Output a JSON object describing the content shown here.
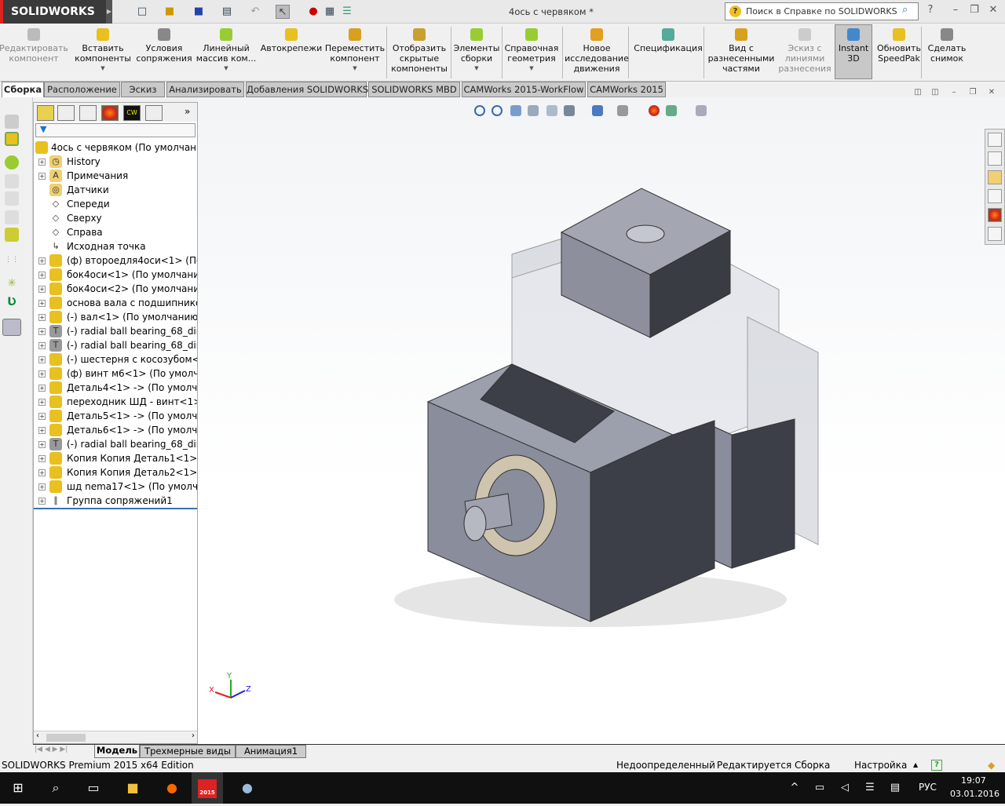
{
  "app": {
    "brand": "SOLIDWORKS",
    "document_title": "4ось с червяком *",
    "help_search_placeholder": "Поиск в Справке по SOLIDWORKS",
    "help_icon": "?"
  },
  "ribbon": {
    "buttons": [
      {
        "label": "Редактировать\nкомпонент",
        "disabled": true,
        "icon": "edit-component-icon"
      },
      {
        "label": "Вставить\nкомпоненты",
        "icon": "insert-components-icon",
        "dropdown": true
      },
      {
        "label": "Условия\nсопряжения",
        "icon": "mate-icon"
      },
      {
        "label": "Линейный\nмассив ком...",
        "icon": "linear-pattern-icon",
        "dropdown": true
      },
      {
        "label": "Автокрепежи",
        "icon": "smart-fasteners-icon"
      },
      {
        "label": "Переместить\nкомпонент",
        "icon": "move-component-icon",
        "dropdown": true
      },
      {
        "label": "Отобразить\nскрытые\nкомпоненты",
        "icon": "show-hidden-icon"
      },
      {
        "label": "Элементы\nсборки",
        "icon": "assembly-features-icon",
        "dropdown": true
      },
      {
        "label": "Справочная\nгеометрия",
        "icon": "reference-geometry-icon",
        "dropdown": true
      },
      {
        "label": "Новое\nисследование\nдвижения",
        "icon": "motion-study-icon"
      },
      {
        "label": "Спецификация",
        "icon": "bom-icon"
      },
      {
        "label": "Вид с\nразнесенными\nчастями",
        "icon": "exploded-view-icon"
      },
      {
        "label": "Эскиз с\nлиниями\nразнесения",
        "disabled": true,
        "icon": "explode-line-sketch-icon"
      },
      {
        "label": "Instant\n3D",
        "active": true,
        "icon": "instant3d-icon"
      },
      {
        "label": "Обновить\nSpeedPak",
        "icon": "speedpak-icon"
      },
      {
        "label": "Сделать\nснимок",
        "icon": "snapshot-icon"
      }
    ]
  },
  "tabs": [
    "Сборка",
    "Расположение",
    "Эскиз",
    "Анализировать",
    "Добавления SOLIDWORKS",
    "SOLIDWORKS MBD",
    "CAMWorks 2015-WorkFlow",
    "CAMWorks 2015"
  ],
  "tree": {
    "root": "4ось с червяком  (По умолчанию",
    "items": [
      {
        "label": "History",
        "icon": "history-icon",
        "expand": true
      },
      {
        "label": "Примечания",
        "icon": "annotations-icon",
        "expand": true
      },
      {
        "label": "Датчики",
        "icon": "sensors-icon",
        "expand": false
      },
      {
        "label": "Спереди",
        "icon": "plane-icon",
        "expand": false
      },
      {
        "label": "Сверху",
        "icon": "plane-icon",
        "expand": false
      },
      {
        "label": "Справа",
        "icon": "plane-icon",
        "expand": false
      },
      {
        "label": "Исходная точка",
        "icon": "origin-icon",
        "expand": false
      },
      {
        "label": "(ф) второедля4оси<1> (По ум",
        "icon": "part-icon",
        "expand": true
      },
      {
        "label": "бок4оси<1> (По умолчанию<",
        "icon": "part-icon",
        "expand": true
      },
      {
        "label": "бок4оси<2> (По умолчанию<",
        "icon": "part-icon",
        "expand": true
      },
      {
        "label": "основа вала с подшипником<",
        "icon": "part-icon",
        "expand": true
      },
      {
        "label": "(-) вал<1> (По умолчанию<<",
        "icon": "part-icon",
        "expand": true
      },
      {
        "label": "(-) radial ball bearing_68_din<1:",
        "icon": "toolbox-part-icon",
        "expand": true
      },
      {
        "label": "(-) radial ball bearing_68_din<2:",
        "icon": "toolbox-part-icon",
        "expand": true
      },
      {
        "label": "(-) шестерня с косозубом<1>",
        "icon": "part-icon",
        "expand": true
      },
      {
        "label": "(ф) винт м6<1> (По умолчани",
        "icon": "part-icon",
        "expand": true
      },
      {
        "label": "Деталь4<1> -> (По умолчани",
        "icon": "part-icon",
        "expand": true
      },
      {
        "label": "переходник ШД - винт<1> (Пс",
        "icon": "part-icon",
        "expand": true
      },
      {
        "label": "Деталь5<1> -> (По умолчани",
        "icon": "part-icon",
        "expand": true
      },
      {
        "label": "Деталь6<1> -> (По умолчани",
        "icon": "part-icon",
        "expand": true
      },
      {
        "label": "(-) radial ball bearing_68_din<3:",
        "icon": "toolbox-part-icon",
        "expand": true
      },
      {
        "label": "Копия Копия Деталь1<1> (По",
        "icon": "part-icon",
        "expand": true
      },
      {
        "label": "Копия Копия Деталь2<1> (По",
        "icon": "part-icon",
        "expand": true
      },
      {
        "label": "шд nema17<1> (По умолчани",
        "icon": "part-icon",
        "expand": true
      },
      {
        "label": "Группа сопряжений1",
        "icon": "mates-icon",
        "expand": true
      }
    ]
  },
  "bottom_tabs": [
    "Модель",
    "Трехмерные виды",
    "Анимация1"
  ],
  "status": {
    "edition": "SOLIDWORKS Premium 2015 x64 Edition",
    "definition": "Недоопределенный",
    "editing": "Редактируется Сборка",
    "custom": "Настройка"
  },
  "triad": {
    "x": "X",
    "y": "Y",
    "z": "Z"
  },
  "taskbar": {
    "lang": "РУС",
    "time": "19:07",
    "date": "03.01.2016",
    "sw_label": "2015"
  },
  "colors": {
    "part": "#8c8f9e",
    "part_dark": "#3a3c44",
    "transparent": "#c8ccd8",
    "accent": "#3a6fb0"
  }
}
